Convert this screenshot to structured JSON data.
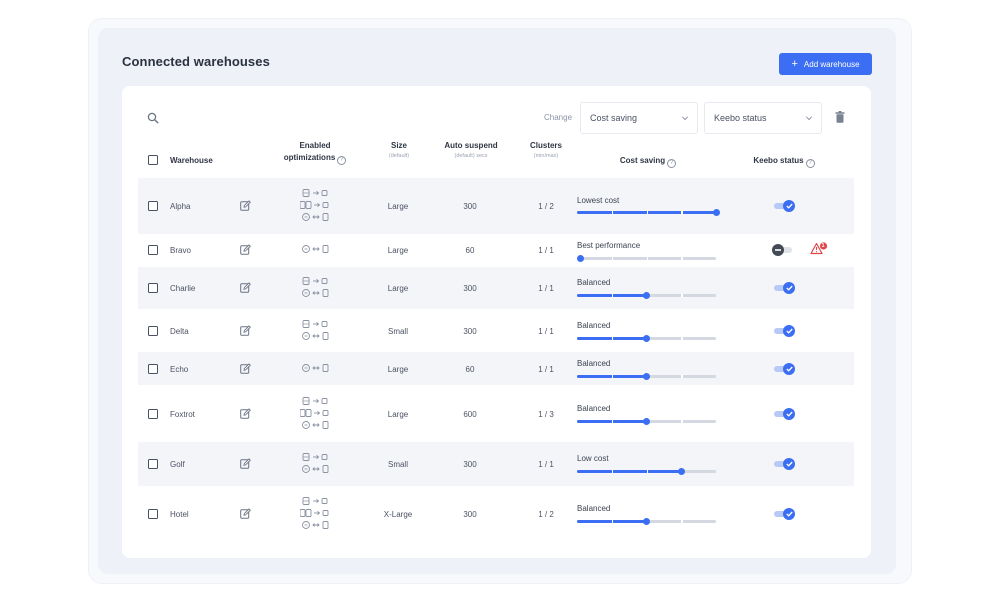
{
  "header": {
    "title": "Connected warehouses",
    "add_button": "Add warehouse"
  },
  "toolbar": {
    "change_label": "Change",
    "cost_select": "Cost saving",
    "status_select": "Keebo status"
  },
  "columns": {
    "warehouse": "Warehouse",
    "enabled_1": "Enabled",
    "enabled_2": "optimizations",
    "size": "Size",
    "size_sub": "(default)",
    "auto": "Auto suspend",
    "auto_sub": "(default) secs",
    "clusters": "Clusters",
    "clusters_sub": "(min/max)",
    "cost": "Cost saving",
    "status": "Keebo status"
  },
  "colors": {
    "accent": "#3b6ef3",
    "danger": "#e0454a"
  },
  "rows": [
    {
      "name": "Alpha",
      "size": "Large",
      "auto": "300",
      "clusters": "1 / 2",
      "cost": "Lowest cost",
      "level": 1.0,
      "enabled": true,
      "opt_lines": 3
    },
    {
      "name": "Bravo",
      "size": "Large",
      "auto": "60",
      "clusters": "1 / 1",
      "cost": "Best performance",
      "level": 0.0,
      "enabled": false,
      "opt_lines": 1
    },
    {
      "name": "Charlie",
      "size": "Large",
      "auto": "300",
      "clusters": "1 / 1",
      "cost": "Balanced",
      "level": 0.5,
      "enabled": true,
      "opt_lines": 2
    },
    {
      "name": "Delta",
      "size": "Small",
      "auto": "300",
      "clusters": "1 / 1",
      "cost": "Balanced",
      "level": 0.5,
      "enabled": true,
      "opt_lines": 2
    },
    {
      "name": "Echo",
      "size": "Large",
      "auto": "60",
      "clusters": "1 / 1",
      "cost": "Balanced",
      "level": 0.5,
      "enabled": true,
      "opt_lines": 1
    },
    {
      "name": "Foxtrot",
      "size": "Large",
      "auto": "600",
      "clusters": "1 / 3",
      "cost": "Balanced",
      "level": 0.5,
      "enabled": true,
      "opt_lines": 3
    },
    {
      "name": "Golf",
      "size": "Small",
      "auto": "300",
      "clusters": "1 / 1",
      "cost": "Low cost",
      "level": 0.75,
      "enabled": true,
      "opt_lines": 2
    },
    {
      "name": "Hotel",
      "size": "X-Large",
      "auto": "300",
      "clusters": "1 / 2",
      "cost": "Balanced",
      "level": 0.5,
      "enabled": true,
      "opt_lines": 3
    }
  ],
  "status_alert_count": "1"
}
